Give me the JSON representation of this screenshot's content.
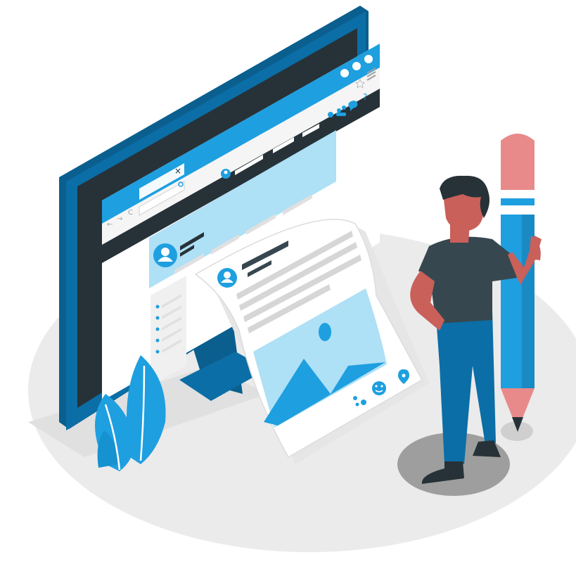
{
  "browser": {
    "close_glyph": "×",
    "nav_back_glyph": "←",
    "nav_forward_glyph": "→",
    "nav_reload_glyph": "C",
    "help_glyph": "?"
  },
  "colors": {
    "primary_blue": "#1e9fe0",
    "dark_navy": "#263238",
    "monitor_blue": "#0a6aa0",
    "light_blue": "#aee0f6",
    "pencil_pink": "#e98a8a",
    "skin": "#c9605a",
    "shirt": "#37474f",
    "floor_gray": "#ebebeb"
  },
  "icons": [
    "avatar-icon",
    "image-placeholder-icon",
    "mountain-icon",
    "sun-icon",
    "bell-icon",
    "users-icon",
    "chat-icon",
    "star-icon",
    "menu-icon",
    "location-pin-icon",
    "emoji-icon",
    "leaf-icon",
    "pencil-icon"
  ]
}
